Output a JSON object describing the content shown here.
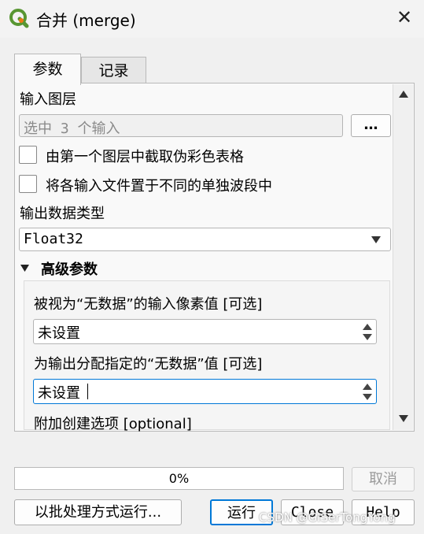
{
  "window": {
    "title": "合并 (merge)",
    "close_icon": "close-icon"
  },
  "tabs": [
    {
      "label": "参数"
    },
    {
      "label": "记录"
    }
  ],
  "params": {
    "input_layers_label": "输入图层",
    "input_layers_value": "选中 3 个输入",
    "browse_label": "…",
    "pseudocolor_label": "由第一个图层中截取伪彩色表格",
    "separate_bands_label": "将各输入文件置于不同的单独波段中",
    "output_type_label": "输出数据类型",
    "output_type_value": "Float32",
    "advanced_label": "高级参数",
    "nodata_input_label": "被视为“无数据”的输入像素值 [可选]",
    "nodata_input_value": "未设置",
    "nodata_output_label": "为输出分配指定的“无数据”值 [可选]",
    "nodata_output_value": "未设置",
    "creation_options_label": "附加创建选项 [optional]"
  },
  "footer": {
    "progress_text": "0%",
    "progress": 0,
    "cancel_label": "取消",
    "batch_label": "以批处理方式运行...",
    "run_label": "运行",
    "close_label": "Close",
    "help_label": "Help",
    "watermark": "CSDN @GISerTongYong"
  },
  "colors": {
    "accent": "#0078d7",
    "qgis_green": "#589632",
    "qgis_yellow": "#ee7913"
  }
}
